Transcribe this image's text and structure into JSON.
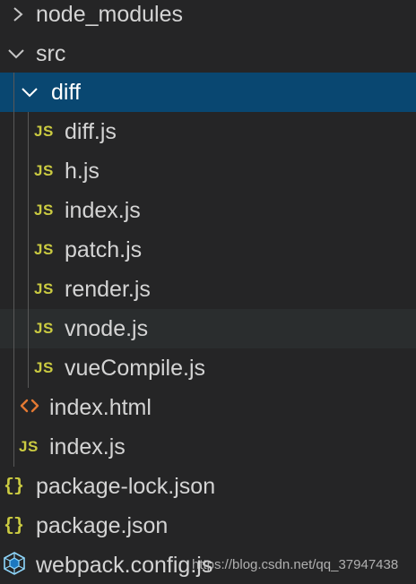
{
  "tree": {
    "items": [
      {
        "label": "node_modules",
        "kind": "folder",
        "expanded": false
      },
      {
        "label": "src",
        "kind": "folder",
        "expanded": true
      },
      {
        "label": "diff",
        "kind": "folder",
        "expanded": true,
        "selected": true
      },
      {
        "label": "diff.js",
        "kind": "js",
        "icon": "JS"
      },
      {
        "label": "h.js",
        "kind": "js",
        "icon": "JS"
      },
      {
        "label": "index.js",
        "kind": "js",
        "icon": "JS"
      },
      {
        "label": "patch.js",
        "kind": "js",
        "icon": "JS"
      },
      {
        "label": "render.js",
        "kind": "js",
        "icon": "JS"
      },
      {
        "label": "vnode.js",
        "kind": "js",
        "icon": "JS",
        "hovered": true
      },
      {
        "label": "vueCompile.js",
        "kind": "js",
        "icon": "JS"
      },
      {
        "label": "index.html",
        "kind": "html",
        "icon": "<>"
      },
      {
        "label": "index.js",
        "kind": "js",
        "icon": "JS"
      },
      {
        "label": "package-lock.json",
        "kind": "json",
        "icon": "{}"
      },
      {
        "label": "package.json",
        "kind": "json",
        "icon": "{}"
      },
      {
        "label": "webpack.config.js",
        "kind": "webpack",
        "icon": "webpack-cube"
      }
    ]
  },
  "watermark": "https://blog.csdn.net/qq_37947438",
  "colors": {
    "background": "#252526",
    "selected": "#094771",
    "hover": "#2a2d2e",
    "js_icon": "#cbcb41",
    "html_icon": "#e37933",
    "webpack_icon": "#8ed6fb",
    "text": "#d4d4d4"
  }
}
